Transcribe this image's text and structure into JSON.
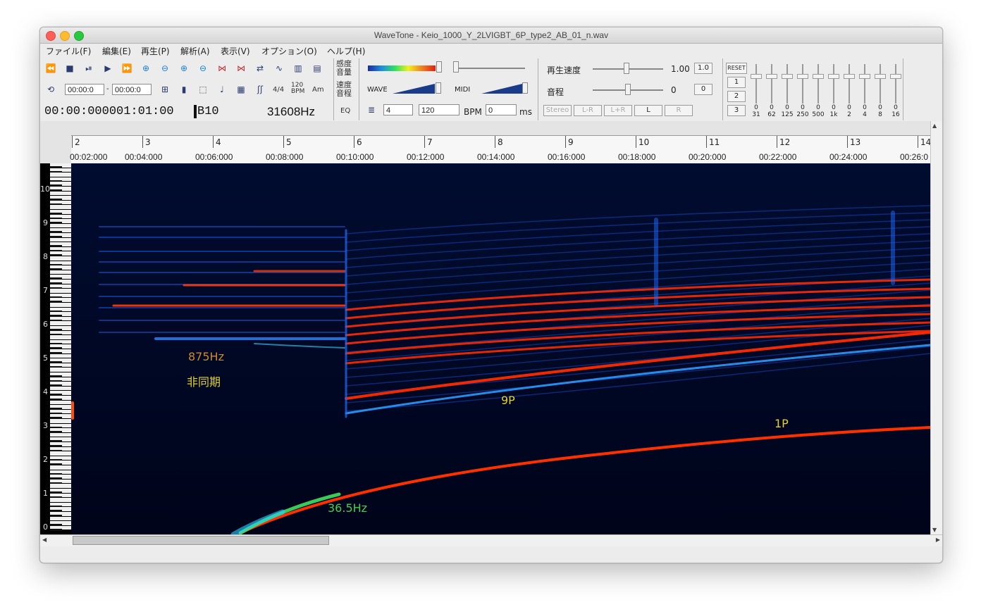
{
  "window": {
    "title": "WaveTone - Keio_1000_Y_2LVIGBT_6P_type2_AB_01_n.wav"
  },
  "menu": [
    "ファイル(F)",
    "編集(E)",
    "再生(P)",
    "解析(A)",
    "表示(V)",
    "オプション(O)",
    "ヘルプ(H)"
  ],
  "toolbar": {
    "time_field_1": "00:00:0",
    "time_field_2": "00:00:0",
    "time_sig": "4/4",
    "bpm_small": "120\nBPM",
    "key_small": "Am",
    "position": "00:00:000001:01:00",
    "note": "B10",
    "frequency": "31608Hz",
    "sensitivity_label": "感度\n音量",
    "speed_label": "速度\n音程",
    "eq_label": "EQ",
    "wave_label": "WAVE",
    "midi_label": "MIDI",
    "beats_value": "4",
    "tempo_value": "120",
    "bpm_label": "BPM",
    "ms_value": "0",
    "ms_label": "ms"
  },
  "playback": {
    "speed_label": "再生速度",
    "speed_value": "1.00",
    "speed_reset": "1.0",
    "pitch_label": "音程",
    "pitch_value": "0",
    "pitch_reset": "0",
    "channels": [
      "Stereo",
      "L-R",
      "L+R",
      "L",
      "R"
    ]
  },
  "eq": {
    "reset": "RESET",
    "presets": [
      "1",
      "2",
      "3"
    ],
    "values": [
      "0",
      "0",
      "0",
      "0",
      "0",
      "0",
      "0",
      "0",
      "0",
      "0"
    ],
    "bands": [
      "31",
      "62",
      "125",
      "250",
      "500",
      "1k",
      "2",
      "4",
      "8",
      "16"
    ]
  },
  "timeline": {
    "bars": [
      "2",
      "3",
      "4",
      "5",
      "6",
      "7",
      "8",
      "9",
      "10",
      "11",
      "12",
      "13",
      "14"
    ],
    "times": [
      "00:02:000",
      "00:04:000",
      "00:06:000",
      "00:08:000",
      "00:10:000",
      "00:12:000",
      "00:14:000",
      "00:16:000",
      "00:18:000",
      "00:20:000",
      "00:22:000",
      "00:24:000",
      "00:26:0"
    ]
  },
  "freq_axis": [
    "10",
    "9",
    "8",
    "7",
    "6",
    "5",
    "4",
    "3",
    "2",
    "1",
    "0"
  ],
  "annotations": {
    "a875": "875Hz",
    "async": "非同期",
    "p9": "9P",
    "p1": "1P",
    "f365": "36.5Hz"
  },
  "colors": {
    "spectrogram_bg": "#000820",
    "hot": "#ff2a00",
    "mid": "#2ae060",
    "cool": "#1060ff"
  }
}
